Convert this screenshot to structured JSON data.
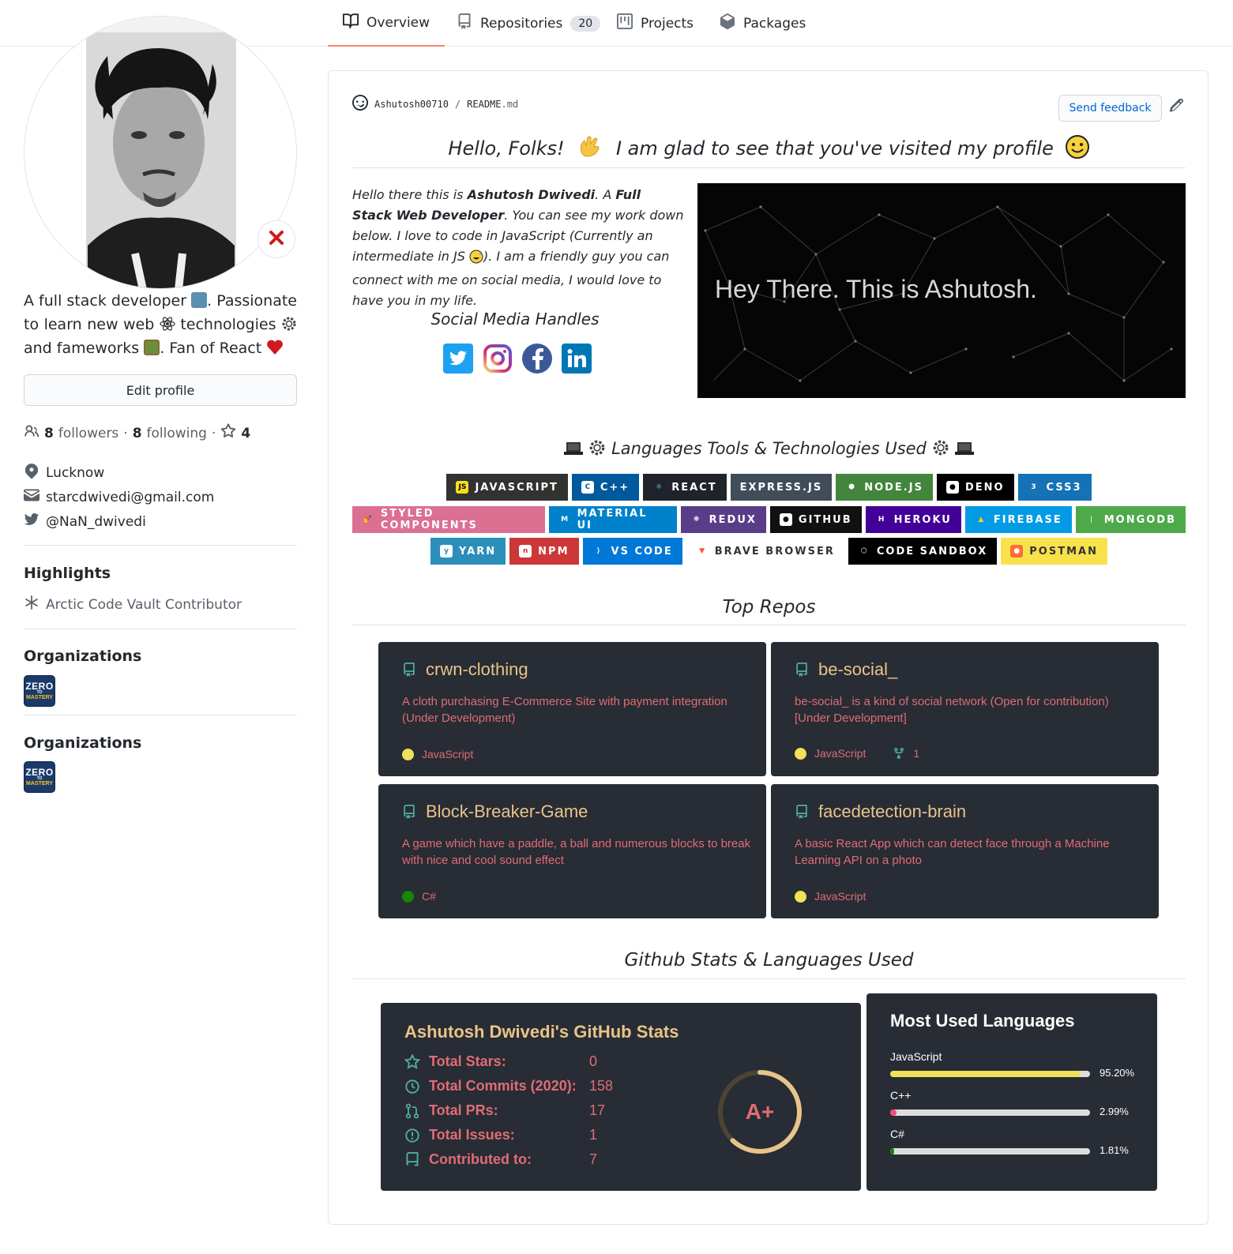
{
  "nav": {
    "tabs": [
      {
        "label": "Overview",
        "icon": "book-icon"
      },
      {
        "label": "Repositories",
        "icon": "repo-icon",
        "count": "20"
      },
      {
        "label": "Projects",
        "icon": "project-icon"
      },
      {
        "label": "Packages",
        "icon": "package-icon"
      }
    ]
  },
  "sidebar": {
    "bio": {
      "p1": "A full stack developer",
      "p2": ". Passionate to learn new web",
      "p3": "technologies",
      "p4": "and fameworks",
      "p5": ". Fan of React"
    },
    "edit_profile": "Edit profile",
    "followers_count": "8",
    "followers_label": "followers",
    "following_count": "8",
    "following_label": "following",
    "stars_count": "4",
    "location": "Lucknow",
    "email": "starcdwivedi@gmail.com",
    "twitter": "@NaN_dwivedi",
    "highlights_title": "Highlights",
    "highlight_item": "Arctic Code Vault Contributor",
    "organizations_title": "Organizations",
    "org_logo_text": {
      "top": "ZERO",
      "mid": "TO",
      "bottom": "MASTERY"
    }
  },
  "readme": {
    "owner": "Ashutosh00710",
    "separator": "/",
    "filename": "README",
    "ext": ".md",
    "feedback": "Send feedback",
    "greeting_a": "Hello, Folks!",
    "greeting_b": "I am glad to see that you've visited my profile",
    "intro": {
      "a": "Hello there this is ",
      "name": "Ashutosh Dwivedi",
      "b": ". A ",
      "role": "Full Stack Web Developer",
      "c": ". You can see my work down below. I love to code in JavaScript (Currently an intermediate in JS ",
      "d": "). I am a friendly guy you can connect with me on social media, I would love to have you in my life."
    },
    "social_title": "Social Media Handles",
    "hero_text": "Hey There. This is Ashutosh.",
    "tools_title": "Languages Tools & Technologies Used",
    "badges_row1": [
      {
        "label": "JAVASCRIPT",
        "bg": "#323330",
        "icon_bg": "#f7df1e",
        "icon_fg": "#000000",
        "glyph": "JS"
      },
      {
        "label": "C++",
        "bg": "#00599c",
        "icon_bg": "#ffffff",
        "icon_fg": "#00599c",
        "glyph": "C"
      },
      {
        "label": "REACT",
        "bg": "#20232a",
        "icon_bg": "#20232a",
        "icon_fg": "#61dafb",
        "glyph": "⚛"
      },
      {
        "label": "EXPRESS.JS",
        "bg": "#404d59",
        "icon_bg": "",
        "icon_fg": "",
        "glyph": ""
      },
      {
        "label": "NODE.JS",
        "bg": "#43853d",
        "icon_bg": "#43853d",
        "icon_fg": "#ffffff",
        "glyph": "⬢"
      },
      {
        "label": "DENO",
        "bg": "#000000",
        "icon_bg": "#ffffff",
        "icon_fg": "#000000",
        "glyph": "●"
      },
      {
        "label": "CSS3",
        "bg": "#1572b6",
        "icon_bg": "#1572b6",
        "icon_fg": "#ffffff",
        "glyph": "3"
      }
    ],
    "badges_row2": [
      {
        "label": "STYLED COMPONENTS",
        "bg": "#db7093",
        "icon_bg": "#db7093",
        "icon_fg": "#ffffff",
        "glyph": "💅"
      },
      {
        "label": "MATERIAL UI",
        "bg": "#0081cb",
        "icon_bg": "#0081cb",
        "icon_fg": "#ffffff",
        "glyph": "M"
      },
      {
        "label": "REDUX",
        "bg": "#593d88",
        "icon_bg": "#593d88",
        "icon_fg": "#ffffff",
        "glyph": "❋"
      },
      {
        "label": "GITHUB",
        "bg": "#121011",
        "icon_bg": "#ffffff",
        "icon_fg": "#121011",
        "glyph": "●"
      },
      {
        "label": "HEROKU",
        "bg": "#430098",
        "icon_bg": "#430098",
        "icon_fg": "#ffffff",
        "glyph": "H"
      },
      {
        "label": "FIREBASE",
        "bg": "#039be5",
        "icon_bg": "#039be5",
        "icon_fg": "#ffca28",
        "glyph": "▲"
      },
      {
        "label": "MONGODB",
        "bg": "#4ea94b",
        "icon_bg": "#4ea94b",
        "icon_fg": "#ffffff",
        "glyph": "❘"
      }
    ],
    "badges_row3": [
      {
        "label": "YARN",
        "bg": "#2c8ebb",
        "icon_bg": "#ffffff",
        "icon_fg": "#2c8ebb",
        "glyph": "y"
      },
      {
        "label": "NPM",
        "bg": "#cb3837",
        "icon_bg": "#ffffff",
        "icon_fg": "#cb3837",
        "glyph": "n"
      },
      {
        "label": "VS CODE",
        "bg": "#0078d7",
        "icon_bg": "#0078d7",
        "icon_fg": "#ffffff",
        "glyph": "⟩"
      },
      {
        "label": "BRAVE BROWSER",
        "bg": "#ffffff",
        "fg": "#333333",
        "icon_bg": "#ffffff",
        "icon_fg": "#fb542b",
        "glyph": "▼"
      },
      {
        "label": "CODE SANDBOX",
        "bg": "#000000",
        "icon_bg": "#000000",
        "icon_fg": "#ffffff",
        "glyph": "⬡"
      },
      {
        "label": "POSTMAN",
        "bg": "#f8e24c",
        "fg": "#333333",
        "icon_bg": "#ff6c37",
        "icon_fg": "#ffffff",
        "glyph": "●"
      }
    ],
    "top_repos_title": "Top Repos",
    "repos": [
      {
        "name": "crwn-clothing",
        "desc": "A cloth purchasing E-Commerce Site with payment integration (Under Development)",
        "lang": "JavaScript",
        "lang_color": "#f1e05a",
        "forks": ""
      },
      {
        "name": "be-social_",
        "desc": "be-social_ is a kind of social network (Open for contribution) [Under Development]",
        "lang": "JavaScript",
        "lang_color": "#f1e05a",
        "forks": "1"
      },
      {
        "name": "Block-Breaker-Game",
        "desc": "A game which have a paddle, a ball and numerous blocks to break with nice and cool sound effect",
        "lang": "C#",
        "lang_color": "#178600",
        "forks": ""
      },
      {
        "name": "facedetection-brain",
        "desc": "A basic React App which can detect face through a Machine Learning API on a photo",
        "lang": "JavaScript",
        "lang_color": "#f1e05a",
        "forks": ""
      }
    ],
    "stats_section_title": "Github Stats & Languages Used",
    "stats": {
      "title": "Ashutosh Dwivedi's GitHub Stats",
      "rows": [
        {
          "label": "Total Stars:",
          "value": "0",
          "icon": "star-icon"
        },
        {
          "label": "Total Commits (2020):",
          "value": "158",
          "icon": "history-icon"
        },
        {
          "label": "Total PRs:",
          "value": "17",
          "icon": "pull-request-icon"
        },
        {
          "label": "Total Issues:",
          "value": "1",
          "icon": "issue-icon"
        },
        {
          "label": "Contributed to:",
          "value": "7",
          "icon": "repo-icon"
        }
      ],
      "grade": "A+",
      "grade_progress": 0.62
    },
    "languages": {
      "title": "Most Used Languages",
      "items": [
        {
          "name": "JavaScript",
          "pct": "95.20%",
          "value": 95.2,
          "color": "#f1e05a"
        },
        {
          "name": "C++",
          "pct": "2.99%",
          "value": 2.99,
          "color": "#f34b7d"
        },
        {
          "name": "C#",
          "pct": "1.81%",
          "value": 1.81,
          "color": "#178600"
        }
      ]
    }
  },
  "colors": {
    "accent_tab": "#f9826c",
    "link": "#0366d6",
    "card_bg": "#282c34",
    "repo_title": "#e8c48a",
    "repo_desc": "#e06c75"
  }
}
